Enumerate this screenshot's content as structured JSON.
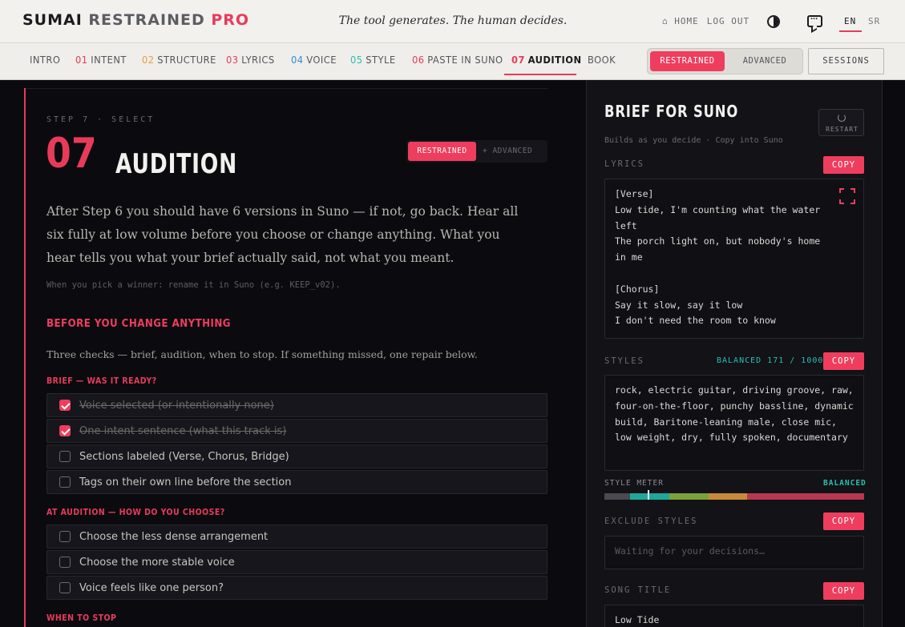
{
  "header": {
    "brand_part1": "SUMAI",
    "brand_part2": "RESTRAINED",
    "brand_part3": "PRO",
    "tagline": "The tool generates. The human decides.",
    "home_label": "⌂ HOME",
    "logout_label": "LOG OUT",
    "lang_en": "EN",
    "lang_sr": "SR",
    "icons": [
      "theme-toggle-icon",
      "chat-icon"
    ]
  },
  "nav": {
    "tabs": [
      {
        "num": "",
        "label": "INTRO",
        "color": "#55555c"
      },
      {
        "num": "01",
        "label": "INTENT",
        "color": "#e83b5a"
      },
      {
        "num": "02",
        "label": "STRUCTURE",
        "color": "#e8a03b"
      },
      {
        "num": "03",
        "label": "LYRICS",
        "color": "#e83b5a"
      },
      {
        "num": "04",
        "label": "VOICE",
        "color": "#2f8fd6"
      },
      {
        "num": "05",
        "label": "STYLE",
        "color": "#2bbfb0"
      },
      {
        "num": "06",
        "label": "PASTE IN SUNO",
        "color": "#e83b5a"
      },
      {
        "num": "07",
        "label": "AUDITION",
        "color": "#e83b5a"
      },
      {
        "num": "",
        "label": "BOOK",
        "color": "#55555c"
      }
    ],
    "active_tab": "AUDITION",
    "mode_restrained": "RESTRAINED",
    "mode_advanced": "ADVANCED",
    "sessions_label": "SESSIONS"
  },
  "main": {
    "step_label": "STEP 7 · SELECT",
    "step_number": "07",
    "title": "AUDITION",
    "mini_restrained": "RESTRAINED",
    "mini_advanced": "+ ADVANCED",
    "intro": "After Step 6 you should have 6 versions in Suno — if not, go back. Hear all six fully at low volume before you choose or change anything. What you hear tells you what your brief actually said, not what you meant.",
    "hint": "When you pick a winner: rename it in Suno (e.g. KEEP_v02).",
    "section_title": "BEFORE YOU CHANGE ANYTHING",
    "checks_intro": "Three checks — brief, audition, when to stop. If something missed, one repair below.",
    "group_brief": "BRIEF — WAS IT READY?",
    "brief_items": [
      {
        "label": "Voice selected (or intentionally none)",
        "checked": true
      },
      {
        "label": "One intent sentence (what this track is)",
        "checked": true
      },
      {
        "label": "Sections labeled (Verse, Chorus, Bridge)",
        "checked": false
      },
      {
        "label": "Tags on their own line before the section",
        "checked": false
      }
    ],
    "group_audition": "AT AUDITION — HOW DO YOU CHOOSE?",
    "audition_items": [
      {
        "label": "Choose the less dense arrangement",
        "checked": false
      },
      {
        "label": "Choose the more stable voice",
        "checked": false
      },
      {
        "label": "Voice feels like one person?",
        "checked": false
      }
    ],
    "group_stop": "WHEN TO STOP"
  },
  "panel": {
    "title": "BRIEF FOR SUNO",
    "subtitle": "Builds as you decide · Copy into Suno",
    "restart_label": "RESTART",
    "copy_label": "COPY",
    "lyrics_label": "LYRICS",
    "lyrics_text": "[Verse]\nLow tide, I'm counting what the water left\nThe porch light on, but nobody's home in me\n\n[Chorus]\nSay it slow, say it low\nI don't need the room to know",
    "styles_label": "STYLES",
    "styles_meta": "BALANCED  171 / 1000",
    "styles_text": "rock, electric guitar, driving groove, raw, four-on-the-floor, punchy bassline, dynamic build, Baritone-leaning male, close mic, low weight, dry, fully spoken, documentary",
    "meter_label": "STYLE METER",
    "meter_status": "BALANCED",
    "meter_level": 0.17,
    "meter_segments": [
      {
        "color": "#4a4a52",
        "share": 0.1
      },
      {
        "color": "#1fa89a",
        "share": 0.15
      },
      {
        "color": "#7aa23a",
        "share": 0.15
      },
      {
        "color": "#c88a3a",
        "share": 0.15
      },
      {
        "color": "#b8384f",
        "share": 0.45
      }
    ],
    "exclude_label": "EXCLUDE STYLES",
    "exclude_placeholder": "Waiting for your decisions…",
    "title_label": "SONG TITLE",
    "song_title": "Low Tide"
  }
}
